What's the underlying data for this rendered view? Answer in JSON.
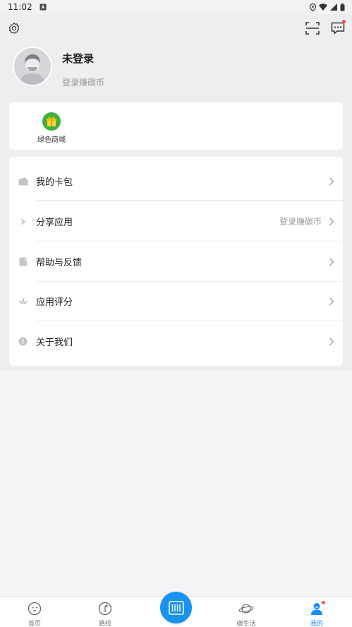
{
  "status_bar": {
    "time": "11:02"
  },
  "profile": {
    "name": "未登录",
    "subtitle": "登录赚碳币"
  },
  "shop": {
    "items": [
      {
        "label": "绿色商城",
        "icon": "gift-icon"
      }
    ]
  },
  "menu": {
    "items": [
      {
        "label": "我的卡包",
        "extra": "",
        "icon": "wallet-icon"
      },
      {
        "label": "分享应用",
        "extra": "登录赚碳币",
        "icon": "share-icon"
      },
      {
        "label": "帮助与反馈",
        "extra": "",
        "icon": "book-icon"
      },
      {
        "label": "应用评分",
        "extra": "",
        "icon": "lotus-icon"
      },
      {
        "label": "关于我们",
        "extra": "",
        "icon": "info-icon"
      }
    ]
  },
  "tabbar": {
    "items": [
      {
        "label": "首页",
        "icon": "home-face-icon"
      },
      {
        "label": "路线",
        "icon": "route-icon"
      },
      {
        "label": "碳生活",
        "icon": "planet-icon"
      },
      {
        "label": "我的",
        "icon": "user-icon"
      }
    ],
    "center_icon": "bus-card-icon"
  },
  "colors": {
    "accent": "#1a8cff",
    "badge": "#ff4d4f",
    "shop_green": "#3fb13f"
  }
}
